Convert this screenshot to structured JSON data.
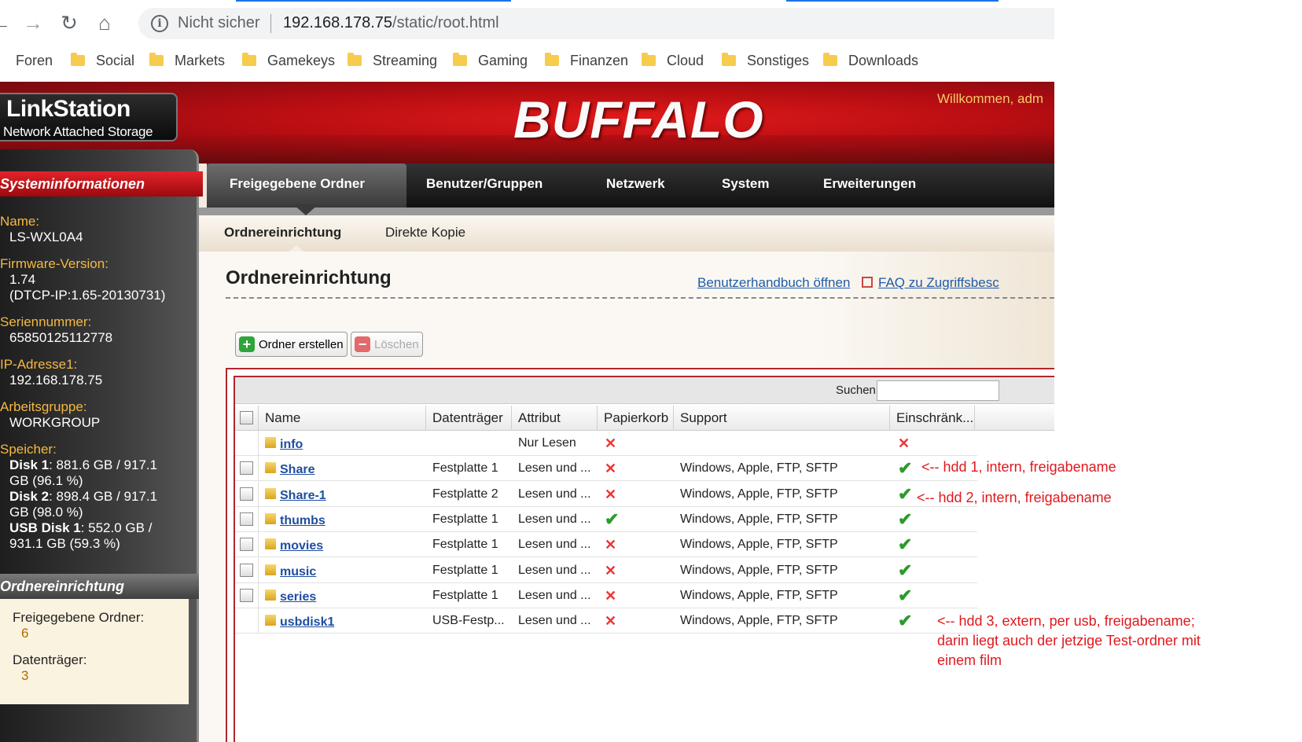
{
  "browser": {
    "insecure_label": "Nicht sicher",
    "url_host": "192.168.178.75",
    "url_path": "/static/root.html",
    "bookmarks": [
      "Foren",
      "Social",
      "Markets",
      "Gamekeys",
      "Streaming",
      "Gaming",
      "Finanzen",
      "Cloud",
      "Sonstiges",
      "Downloads"
    ]
  },
  "header": {
    "logo_name": "LinkStation",
    "logo_subtitle": "Network Attached Storage",
    "brand": "BUFFALO",
    "welcome": "Willkommen, adm"
  },
  "nav": {
    "tabs": [
      "Freigegebene Ordner",
      "Benutzer/Gruppen",
      "Netzwerk",
      "System",
      "Erweiterungen"
    ],
    "subtabs": [
      "Ordnereinrichtung",
      "Direkte Kopie"
    ]
  },
  "sidebar": {
    "section_title": "Systeminformationen",
    "name_label": "Name:",
    "name_value": "LS-WXL0A4",
    "firmware_label": "Firmware-Version:",
    "firmware_value": "1.74",
    "firmware_extra": "(DTCP-IP:1.65-20130731)",
    "serial_label": "Seriennummer:",
    "serial_value": "65850125112778",
    "ip_label": "IP-Adresse1:",
    "ip_value": "192.168.178.75",
    "workgroup_label": "Arbeitsgruppe:",
    "workgroup_value": "WORKGROUP",
    "storage_label": "Speicher:",
    "disk1_name": "Disk 1",
    "disk1_line1": ": 881.6 GB / 917.1",
    "disk1_line2": "GB (96.1 %)",
    "disk2_name": "Disk 2",
    "disk2_line1": ": 898.4 GB / 917.1",
    "disk2_line2": "GB (98.0 %)",
    "usb_name": "USB Disk 1",
    "usb_line1": ": 552.0 GB /",
    "usb_line2": "931.1 GB (59.3 %)",
    "folder_section_title": "Ordnereinrichtung",
    "shared_folders_label": "Freigegebene Ordner:",
    "shared_folders_value": "6",
    "volumes_label": "Datenträger:",
    "volumes_value": "3"
  },
  "main": {
    "title": "Ordnereinrichtung",
    "manual_link": "Benutzerhandbuch öffnen",
    "faq_link": "FAQ zu Zugriffsbesc",
    "create_button": "Ordner erstellen",
    "delete_button": "Löschen",
    "search_label": "Suchen",
    "search_value": "",
    "columns": [
      "Name",
      "Datenträger",
      "Attribut",
      "Papierkorb",
      "Support",
      "Einschränk..."
    ],
    "rows": [
      {
        "name": "info",
        "volume": "",
        "attribute": "Nur Lesen",
        "recycle": "x",
        "support": "",
        "restrict": "x",
        "checkbox": false
      },
      {
        "name": "Share",
        "volume": "Festplatte 1",
        "attribute": "Lesen und ...",
        "recycle": "x",
        "support": "Windows, Apple, FTP, SFTP",
        "restrict": "ok",
        "checkbox": true
      },
      {
        "name": "Share-1",
        "volume": "Festplatte 2",
        "attribute": "Lesen und ...",
        "recycle": "x",
        "support": "Windows, Apple, FTP, SFTP",
        "restrict": "ok",
        "checkbox": true
      },
      {
        "name": "thumbs",
        "volume": "Festplatte 1",
        "attribute": "Lesen und ...",
        "recycle": "ok",
        "support": "Windows, Apple, FTP, SFTP",
        "restrict": "ok",
        "checkbox": true
      },
      {
        "name": "movies",
        "volume": "Festplatte 1",
        "attribute": "Lesen und ...",
        "recycle": "x",
        "support": "Windows, Apple, FTP, SFTP",
        "restrict": "ok",
        "checkbox": true
      },
      {
        "name": "music",
        "volume": "Festplatte 1",
        "attribute": "Lesen und ...",
        "recycle": "x",
        "support": "Windows, Apple, FTP, SFTP",
        "restrict": "ok",
        "checkbox": true
      },
      {
        "name": "series",
        "volume": "Festplatte 1",
        "attribute": "Lesen und ...",
        "recycle": "x",
        "support": "Windows, Apple, FTP, SFTP",
        "restrict": "ok",
        "checkbox": true
      },
      {
        "name": "usbdisk1",
        "volume": "USB-Festp...",
        "attribute": "Lesen und ...",
        "recycle": "x",
        "support": "Windows, Apple, FTP, SFTP",
        "restrict": "ok",
        "checkbox": false
      }
    ]
  },
  "annotations": {
    "hdd1": "<-- hdd 1, intern, freigabename",
    "hdd2": "<-- hdd 2, intern, freigabename",
    "hdd3_line1": "<-- hdd 3, extern, per usb, freigabename;",
    "hdd3_line2": "darin liegt auch der jetzige Test-ordner mit",
    "hdd3_line3": "einem film"
  },
  "colors": {
    "accent_red": "#b1262c",
    "link_blue": "#1f4ea0",
    "annotation_red": "#e0181e",
    "check_green": "#2c9a2c",
    "sidebar_label": "#f4b942"
  },
  "icons": {
    "row_folder": "folder-icon",
    "create": "plus-icon",
    "delete": "minus-icon",
    "recycle_off": "cross-icon",
    "restrict_on": "checkmark-icon"
  }
}
